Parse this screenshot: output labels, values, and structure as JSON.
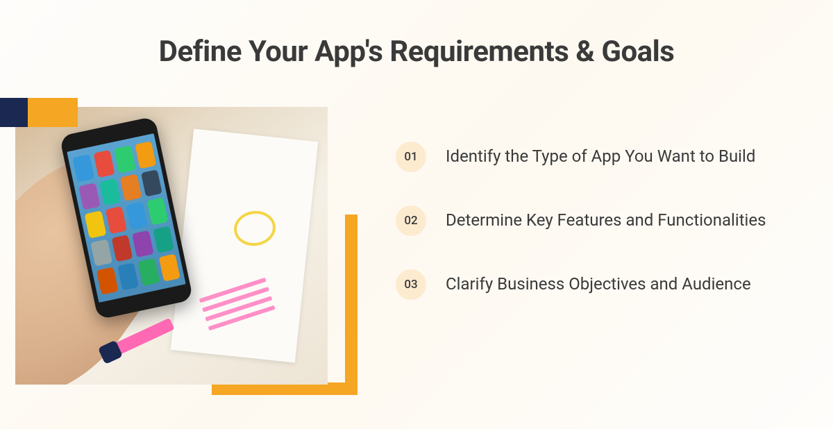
{
  "title": "Define Your App's Requirements & Goals",
  "items": [
    {
      "num": "01",
      "text": "Identify the Type of App You Want to Build"
    },
    {
      "num": "02",
      "text": "Determine Key Features and Functionalities"
    },
    {
      "num": "03",
      "text": "Clarify Business Objectives and Audience"
    }
  ],
  "colors": {
    "navy": "#1a2852",
    "gold": "#f5a623",
    "badge_bg": "#fdebd0",
    "text": "#3a3a3a"
  }
}
